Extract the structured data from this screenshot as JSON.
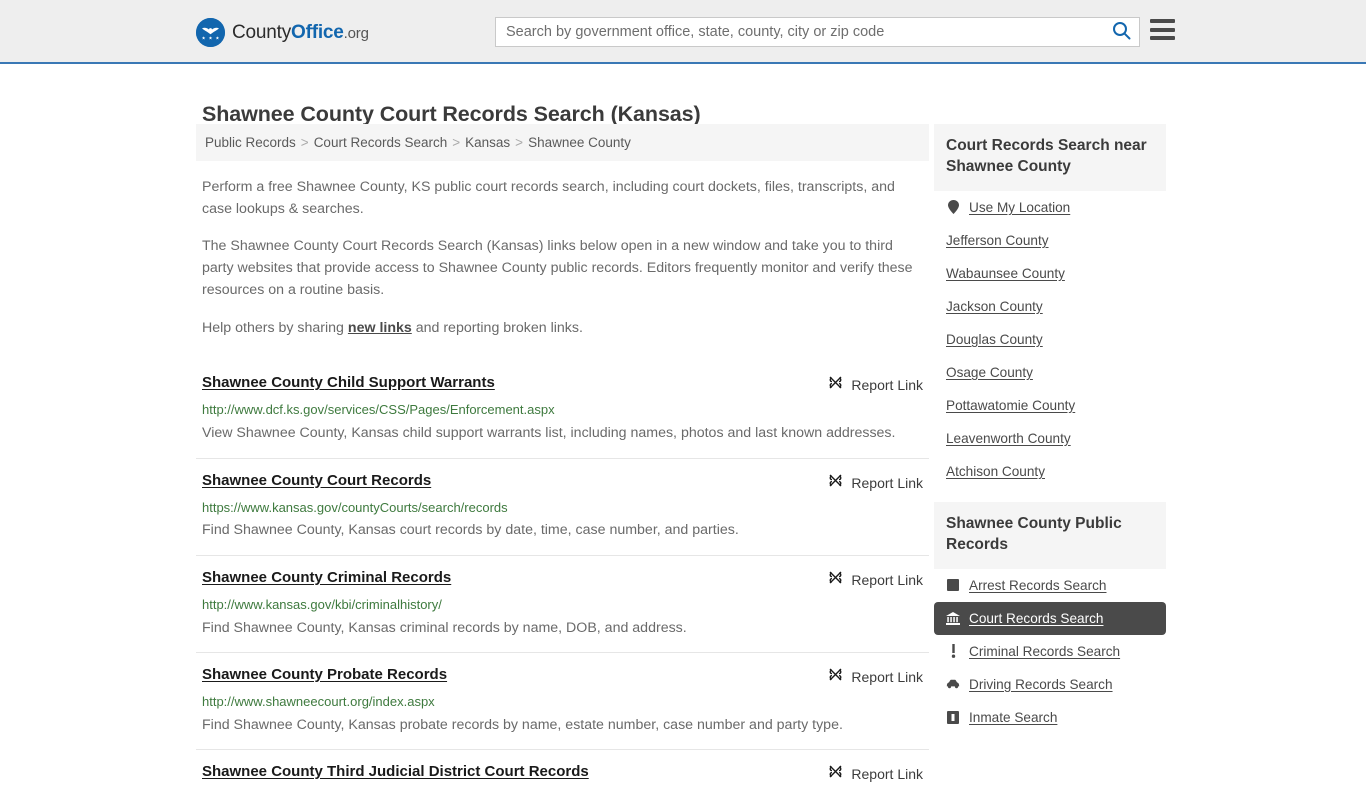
{
  "header": {
    "brand": {
      "part1": "County",
      "part2": "Office",
      "part3": ".org"
    },
    "search": {
      "placeholder": "Search by government office, state, county, city or zip code",
      "value": "",
      "icon": "search-icon"
    },
    "menu_icon": "hamburger-menu-icon"
  },
  "page": {
    "title": "Shawnee County Court Records Search (Kansas)"
  },
  "breadcrumb": {
    "items": [
      {
        "label": "Public Records",
        "link": true
      },
      {
        "label": "Court Records Search",
        "link": true
      },
      {
        "label": "Kansas",
        "link": true
      },
      {
        "label": "Shawnee County",
        "link": false
      }
    ],
    "separator": ">"
  },
  "intro": {
    "paragraph1": "Perform a free Shawnee County, KS public court records search, including court dockets, files, transcripts, and case lookups & searches.",
    "paragraph2": "The Shawnee County Court Records Search (Kansas) links below open in a new window and take you to third party websites that provide access to Shawnee County public records. Editors frequently monitor and verify these resources on a routine basis.",
    "paragraph3_prefix": "Help others by sharing ",
    "paragraph3_link": "new links",
    "paragraph3_suffix": " and reporting broken links."
  },
  "report_link_label": "Report Link",
  "report_link_icon": "broken-link-icon",
  "results": [
    {
      "title": "Shawnee County Child Support Warrants",
      "url": "http://www.dcf.ks.gov/services/CSS/Pages/Enforcement.aspx",
      "description": "View Shawnee County, Kansas child support warrants list, including names, photos and last known addresses."
    },
    {
      "title": "Shawnee County Court Records",
      "url": "https://www.kansas.gov/countyCourts/search/records",
      "description": "Find Shawnee County, Kansas court records by date, time, case number, and parties."
    },
    {
      "title": "Shawnee County Criminal Records",
      "url": "http://www.kansas.gov/kbi/criminalhistory/",
      "description": "Find Shawnee County, Kansas criminal records by name, DOB, and address."
    },
    {
      "title": "Shawnee County Probate Records",
      "url": "http://www.shawneecourt.org/index.aspx",
      "description": "Find Shawnee County, Kansas probate records by name, estate number, case number and party type."
    },
    {
      "title": "Shawnee County Third Judicial District Court Records",
      "url": "",
      "description": ""
    }
  ],
  "sidebar": {
    "nearby": {
      "heading": "Court Records Search near Shawnee County",
      "items": [
        {
          "label": "Use My Location",
          "icon": "map-pin-icon",
          "active": false
        },
        {
          "label": "Jefferson County",
          "icon": "",
          "active": false
        },
        {
          "label": "Wabaunsee County",
          "icon": "",
          "active": false
        },
        {
          "label": "Jackson County",
          "icon": "",
          "active": false
        },
        {
          "label": "Douglas County",
          "icon": "",
          "active": false
        },
        {
          "label": "Osage County",
          "icon": "",
          "active": false
        },
        {
          "label": "Pottawatomie County",
          "icon": "",
          "active": false
        },
        {
          "label": "Leavenworth County",
          "icon": "",
          "active": false
        },
        {
          "label": "Atchison County",
          "icon": "",
          "active": false
        }
      ]
    },
    "public_records": {
      "heading": "Shawnee County Public Records",
      "items": [
        {
          "label": "Arrest Records Search",
          "icon": "fingerprint-card-icon",
          "active": false
        },
        {
          "label": "Court Records Search",
          "icon": "courthouse-icon",
          "active": true
        },
        {
          "label": "Criminal Records Search",
          "icon": "exclamation-icon",
          "active": false
        },
        {
          "label": "Driving Records Search",
          "icon": "car-icon",
          "active": false
        },
        {
          "label": "Inmate Search",
          "icon": "jail-icon",
          "active": false
        }
      ]
    }
  },
  "colors": {
    "header_bg": "#eeeeee",
    "header_border": "#3a78b5",
    "brand_blue": "#1266ae",
    "url_green": "#3e7a3e",
    "panel_bg": "#f5f5f5",
    "active_bg": "#4a4a4a"
  }
}
